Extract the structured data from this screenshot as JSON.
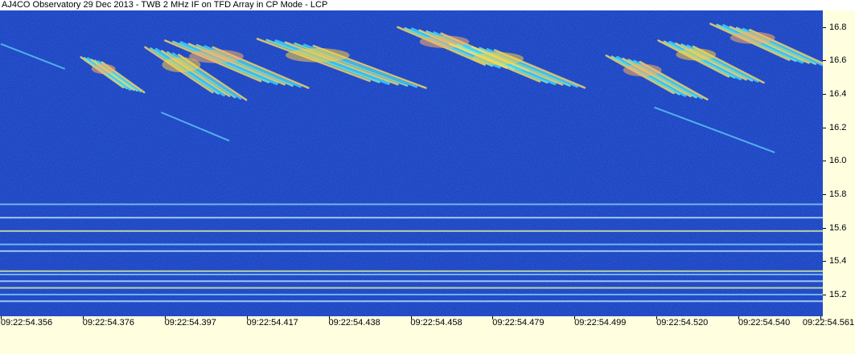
{
  "title": "AJ4CO Observatory 29 Dec 2013 - TWB 2 MHz IF on TFD Array in CP Mode - LCP",
  "chart_data": {
    "type": "heatmap",
    "title": "AJ4CO Observatory 29 Dec 2013 - TWB 2 MHz IF on TFD Array in CP Mode - LCP",
    "xlabel": "",
    "ylabel": "",
    "x_tick_labels": [
      "09:22:54.356",
      "09:22:54.376",
      "09:22:54.397",
      "09:22:54.417",
      "09:22:54.438",
      "09:22:54.458",
      "09:22:54.479",
      "09:22:54.499",
      "09:22:54.520",
      "09:22:54.540",
      "09:22:54.561"
    ],
    "y_tick_labels": [
      "16.8",
      "16.6",
      "16.4",
      "16.2",
      "16.0",
      "15.8",
      "15.6",
      "15.4",
      "15.2"
    ],
    "y_ticks": [
      16.8,
      16.6,
      16.4,
      16.2,
      16.0,
      15.8,
      15.6,
      15.4,
      15.2
    ],
    "ylim": [
      15.07,
      16.9
    ],
    "xlim_seconds": [
      54.356,
      54.561
    ],
    "background_color": "#1f3fbf",
    "narrowband_lines_mhz": [
      15.16,
      15.2,
      15.24,
      15.28,
      15.32,
      15.34,
      15.46,
      15.5,
      15.58,
      15.66,
      15.74
    ],
    "bursts": [
      {
        "t_start": 54.376,
        "t_end": 54.391,
        "f_high": 16.62,
        "f_low": 16.42
      },
      {
        "t_start": 54.392,
        "t_end": 54.416,
        "f_high": 16.68,
        "f_low": 16.38
      },
      {
        "t_start": 54.397,
        "t_end": 54.431,
        "f_high": 16.72,
        "f_low": 16.45
      },
      {
        "t_start": 54.42,
        "t_end": 54.46,
        "f_high": 16.73,
        "f_low": 16.45
      },
      {
        "t_start": 54.455,
        "t_end": 54.486,
        "f_high": 16.8,
        "f_low": 16.55
      },
      {
        "t_start": 54.468,
        "t_end": 54.5,
        "f_high": 16.7,
        "f_low": 16.45
      },
      {
        "t_start": 54.507,
        "t_end": 54.531,
        "f_high": 16.63,
        "f_low": 16.38
      },
      {
        "t_start": 54.52,
        "t_end": 54.545,
        "f_high": 16.72,
        "f_low": 16.48
      },
      {
        "t_start": 54.533,
        "t_end": 54.561,
        "f_high": 16.82,
        "f_low": 16.58
      }
    ],
    "faint_tails": [
      {
        "t_start": 54.356,
        "t_end": 54.372,
        "f_high": 16.7,
        "f_low": 16.55
      },
      {
        "t_start": 54.396,
        "t_end": 54.413,
        "f_high": 16.29,
        "f_low": 16.12
      },
      {
        "t_start": 54.519,
        "t_end": 54.549,
        "f_high": 16.32,
        "f_low": 16.05
      }
    ]
  }
}
